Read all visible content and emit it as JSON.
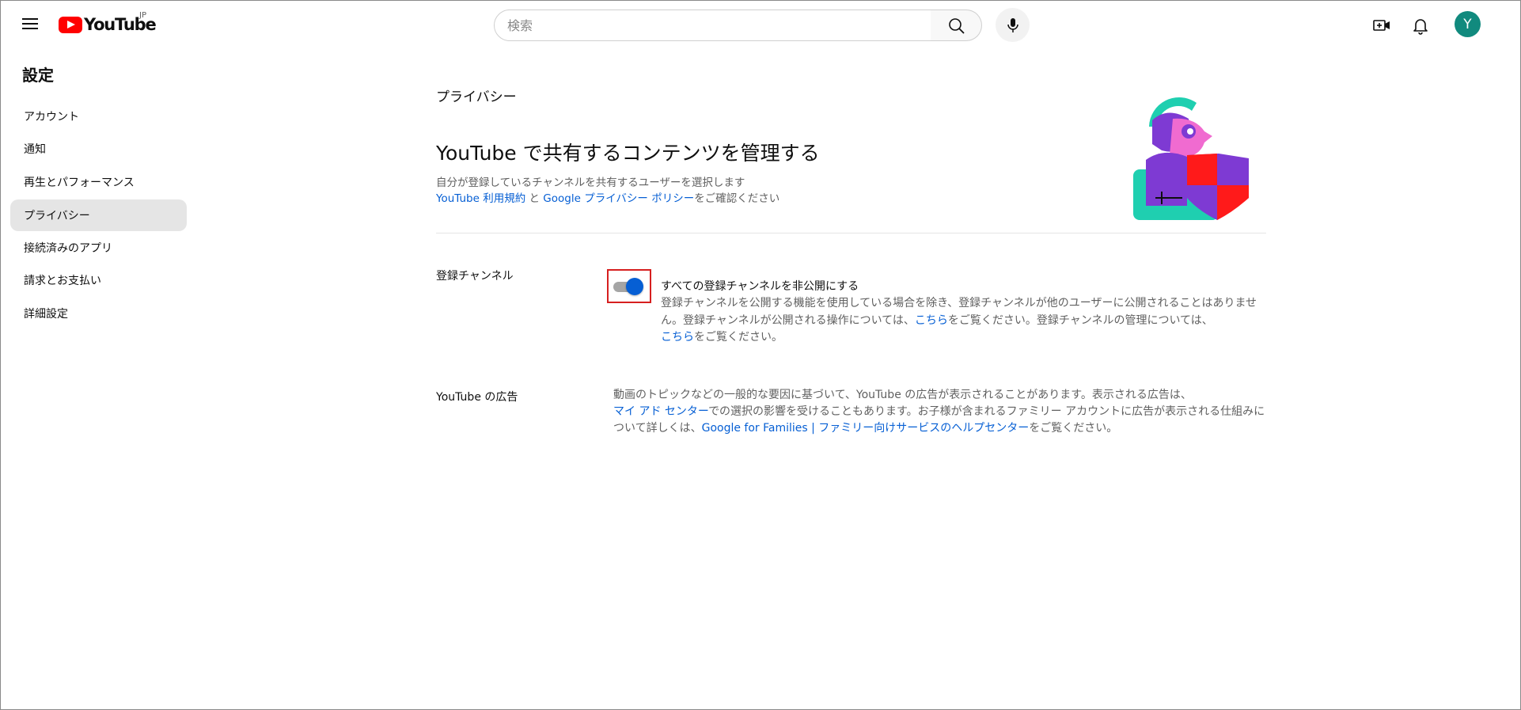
{
  "header": {
    "logo_text": "YouTube",
    "country": "JP",
    "search_placeholder": "検索",
    "avatar_letter": "Y"
  },
  "sidebar": {
    "title": "設定",
    "items": [
      {
        "label": "アカウント",
        "active": false
      },
      {
        "label": "通知",
        "active": false
      },
      {
        "label": "再生とパフォーマンス",
        "active": false
      },
      {
        "label": "プライバシー",
        "active": true
      },
      {
        "label": "接続済みのアプリ",
        "active": false
      },
      {
        "label": "請求とお支払い",
        "active": false
      },
      {
        "label": "詳細設定",
        "active": false
      }
    ]
  },
  "main": {
    "section_label": "プライバシー",
    "title": "YouTube で共有するコンテンツを管理する",
    "subtitle": "自分が登録しているチャンネルを共有するユーザーを選択します",
    "terms_link": "YouTube 利用規約",
    "and_text": " と ",
    "privacy_link": "Google プライバシー ポリシー",
    "confirm_text": "をご確認ください"
  },
  "subscriptions": {
    "label": "登録チャンネル",
    "toggle_on": true,
    "option_title": "すべての登録チャンネルを非公開にする",
    "desc_part1": "登録チャンネルを公開する機能を使用している場合を除き、登録チャンネルが他のユーザーに公開されることはありません。登録チャンネルが公開される操作については、",
    "link1": "こちら",
    "desc_part2": "をご覧ください。登録チャンネルの管理については、",
    "link2": "こちら",
    "desc_part3": "をご覧ください。"
  },
  "ads": {
    "label": "YouTube の広告",
    "desc_part1": "動画のトピックなどの一般的な要因に基づいて、YouTube の広告が表示されることがあります。表示される広告は、",
    "link1": "マイ アド センター",
    "desc_part2": "での選択の影響を受けることもあります。お子様が含まれるファミリー アカウントに広告が表示される仕組みについて詳しくは、",
    "link2": "Google for Families | ファミリー向けサービスのヘルプセンター",
    "desc_part3": "をご覧ください。"
  },
  "colors": {
    "brand_red": "#ff0000",
    "link_blue": "#065fd4",
    "toggle_blue": "#065fd4",
    "avatar_teal": "#118a7e",
    "highlight_red": "#d61f1f"
  },
  "icons": [
    "menu-icon",
    "youtube-logo-icon",
    "search-icon",
    "mic-icon",
    "create-icon",
    "bell-icon",
    "privacy-illustration"
  ]
}
